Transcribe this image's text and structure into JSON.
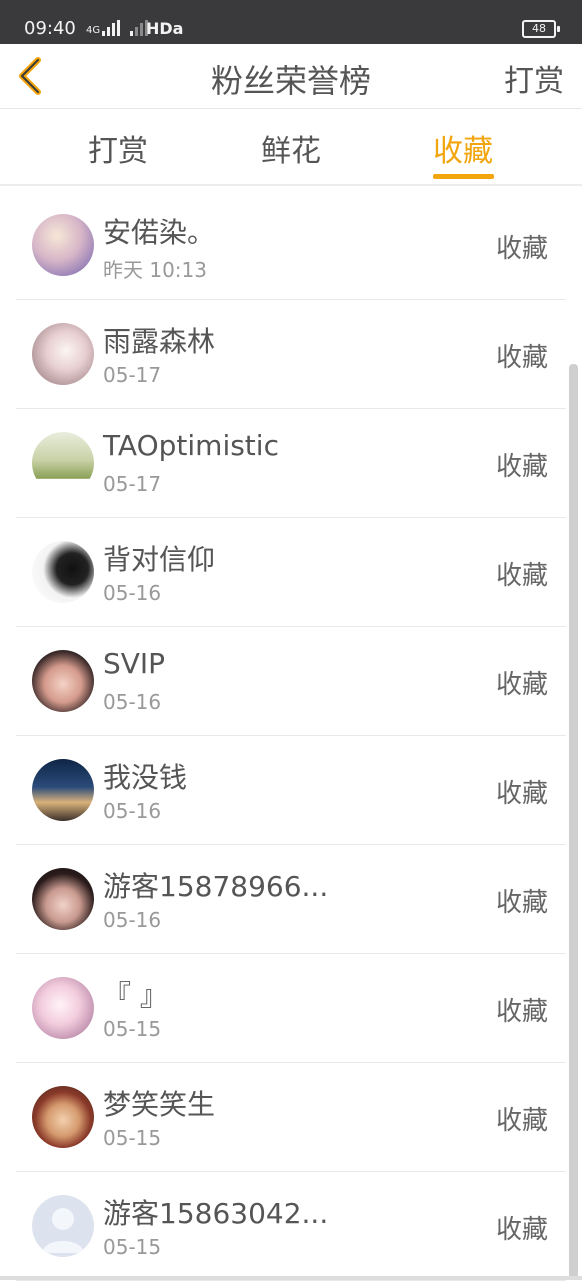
{
  "status_bar": {
    "time": "09:40",
    "network": "4G",
    "connection": "HDa",
    "battery": "48"
  },
  "header": {
    "title": "粉丝荣誉榜",
    "action": "打赏"
  },
  "tabs": [
    {
      "label": "打赏",
      "active": false
    },
    {
      "label": "鲜花",
      "active": false
    },
    {
      "label": "收藏",
      "active": true
    }
  ],
  "accent_color": "#f2a50c",
  "fans": [
    {
      "name": "安偌染。",
      "date": "昨天 10:13",
      "action": "收藏"
    },
    {
      "name": "雨露森林",
      "date": "05-17",
      "action": "收藏"
    },
    {
      "name": "TAOptimistic",
      "date": "05-17",
      "action": "收藏"
    },
    {
      "name": "背对信仰",
      "date": "05-16",
      "action": "收藏"
    },
    {
      "name": "SVIP",
      "date": "05-16",
      "action": "收藏"
    },
    {
      "name": "我没钱",
      "date": "05-16",
      "action": "收藏"
    },
    {
      "name": "游客15878966...",
      "date": "05-16",
      "action": "收藏"
    },
    {
      "name": "『 』",
      "date": "05-15",
      "action": "收藏"
    },
    {
      "name": "梦笑笑生",
      "date": "05-15",
      "action": "收藏"
    },
    {
      "name": "游客15863042...",
      "date": "05-15",
      "action": "收藏"
    }
  ]
}
